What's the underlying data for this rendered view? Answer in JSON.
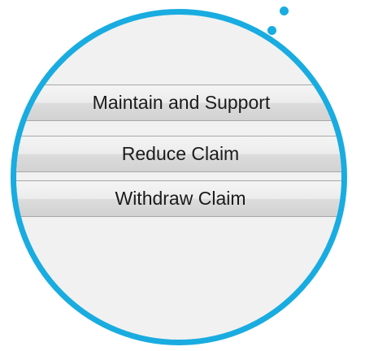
{
  "buttons": {
    "maintain_label": "Maintain and Support",
    "reduce_label": "Reduce Claim",
    "withdraw_label": "Withdraw Claim"
  },
  "colors": {
    "accent": "#19ace0",
    "panel_background": "#f1f1f1",
    "button_border": "#a7a7a7"
  }
}
